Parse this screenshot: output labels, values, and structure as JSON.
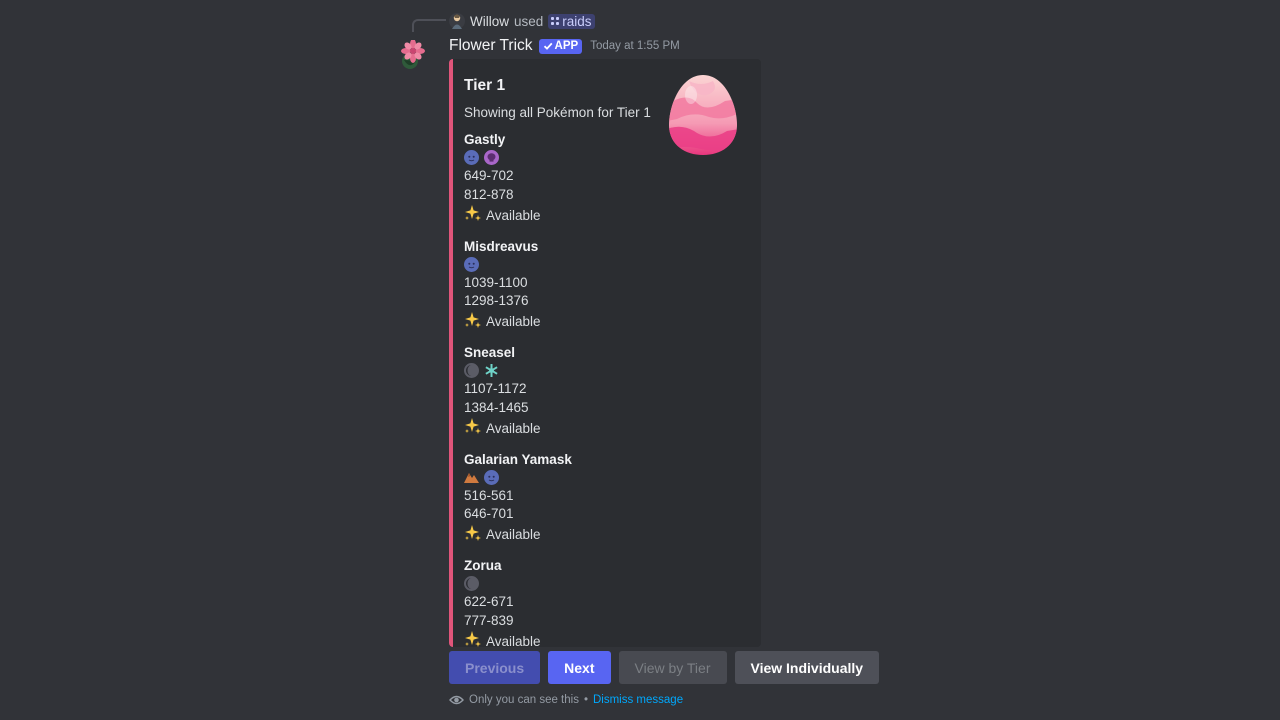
{
  "reply": {
    "user": "Willow",
    "used_text": "used",
    "command": "raids"
  },
  "message": {
    "author": "Flower Trick",
    "badge": "APP",
    "timestamp": "Today at 1:55 PM",
    "accent_color": "#e0557a"
  },
  "embed": {
    "title": "Tier 1",
    "description": "Showing all Pokémon for Tier 1",
    "thumbnail": "raid-egg-pink",
    "pokemon": [
      {
        "name": "Gastly",
        "types": [
          "ghost-type-icon",
          "poison-type-icon"
        ],
        "cp_normal": "649-702",
        "cp_boosted": "812-878",
        "shiny": "Available"
      },
      {
        "name": "Misdreavus",
        "types": [
          "ghost-type-icon"
        ],
        "cp_normal": "1039-1100",
        "cp_boosted": "1298-1376",
        "shiny": "Available"
      },
      {
        "name": "Sneasel",
        "types": [
          "dark-type-icon",
          "ice-type-icon"
        ],
        "cp_normal": "1107-1172",
        "cp_boosted": "1384-1465",
        "shiny": "Available"
      },
      {
        "name": "Galarian Yamask",
        "types": [
          "ground-type-icon",
          "ghost-type-icon"
        ],
        "cp_normal": "516-561",
        "cp_boosted": "646-701",
        "shiny": "Available"
      },
      {
        "name": "Zorua",
        "types": [
          "dark-type-icon"
        ],
        "cp_normal": "622-671",
        "cp_boosted": "777-839",
        "shiny": "Available"
      }
    ]
  },
  "buttons": {
    "previous": "Previous",
    "next": "Next",
    "view_by_tier": "View by Tier",
    "view_individually": "View Individually"
  },
  "ephemeral": {
    "note": "Only you can see this",
    "separator": "•",
    "dismiss": "Dismiss message"
  }
}
